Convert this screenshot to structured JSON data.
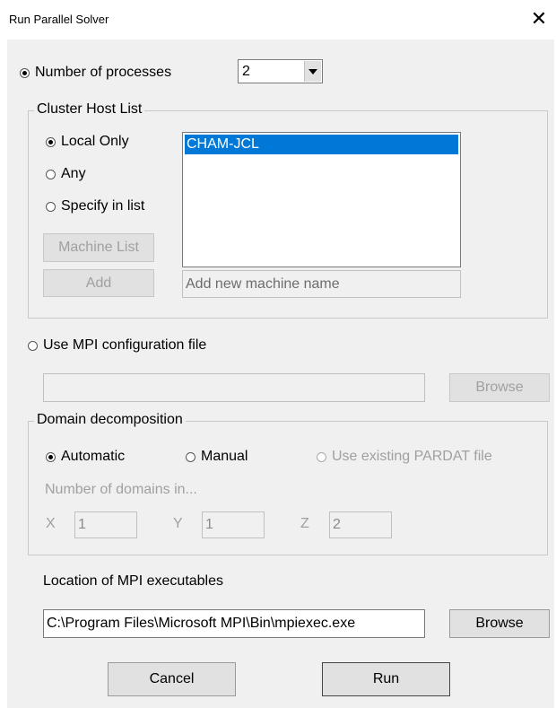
{
  "window": {
    "title": "Run Parallel Solver",
    "close_glyph": "✕"
  },
  "processes": {
    "label": "Number of processes",
    "value": "2"
  },
  "host_list": {
    "title": "Cluster Host List",
    "options": {
      "local": "Local Only",
      "any": "Any",
      "specify": "Specify in list"
    },
    "selected_host": "CHAM-JCL",
    "machine_list_label": "Machine List",
    "add_label": "Add",
    "new_machine_placeholder": "Add new machine name"
  },
  "mpi_config": {
    "label": "Use MPI configuration file",
    "browse_label": "Browse",
    "path": ""
  },
  "domain": {
    "title": "Domain decomposition",
    "automatic": "Automatic",
    "manual": "Manual",
    "existing": "Use existing PARDAT file",
    "count_label": "Number of domains in...",
    "x_label": "X",
    "x_value": "1",
    "y_label": "Y",
    "y_value": "1",
    "z_label": "Z",
    "z_value": "2"
  },
  "executables": {
    "label": "Location of MPI executables",
    "path": "C:\\Program Files\\Microsoft MPI\\Bin\\mpiexec.exe",
    "browse_label": "Browse"
  },
  "actions": {
    "cancel_label": "Cancel",
    "run_label": "Run"
  }
}
